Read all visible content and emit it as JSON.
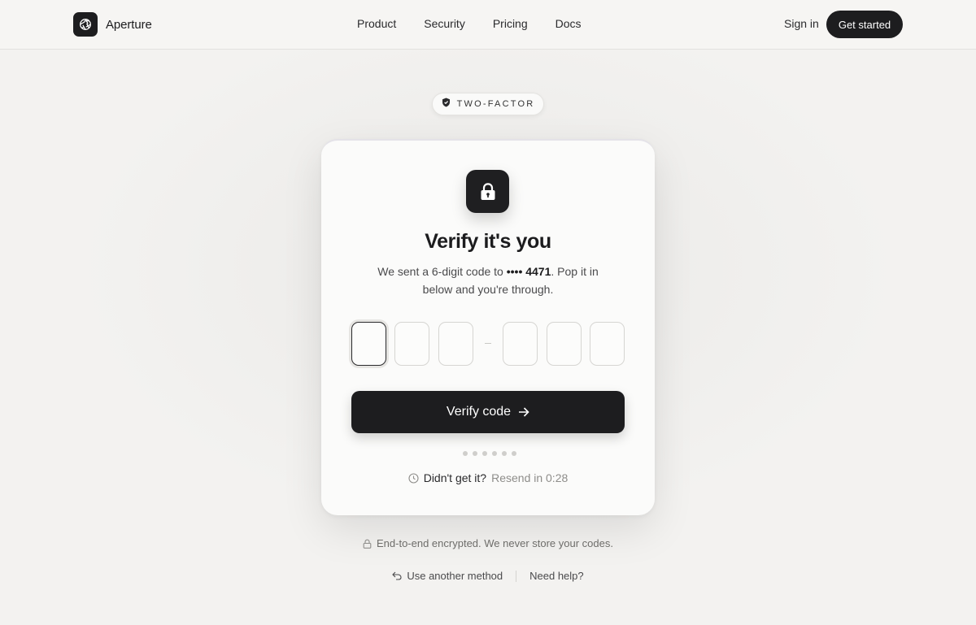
{
  "header": {
    "brand": "Aperture",
    "nav": [
      "Product",
      "Security",
      "Pricing",
      "Docs"
    ],
    "sign_in": "Sign in",
    "get_started": "Get started"
  },
  "badge": {
    "label": "TWO-FACTOR",
    "icon": "shield-check-icon"
  },
  "card": {
    "icon": "lock-icon",
    "title": "Verify it's you",
    "subtitle_prefix": "We sent a 6-digit code to ",
    "masked_number": "•••• 4471",
    "subtitle_suffix": ". Pop it in below and you're through.",
    "code_values": [
      "",
      "",
      "",
      "",
      "",
      ""
    ],
    "verify_label": "Verify code",
    "progress_dots": 6,
    "resend_question": "Didn't get it?",
    "resend_timer": "Resend in 0:28"
  },
  "footer": {
    "encryption_note": "End-to-end encrypted. We never store your codes.",
    "alt_method": "Use another method",
    "help": "Need help?"
  },
  "colors": {
    "accent": "#1d1d1f",
    "background": "#f3f2f0",
    "card": "#fbfbfa"
  }
}
